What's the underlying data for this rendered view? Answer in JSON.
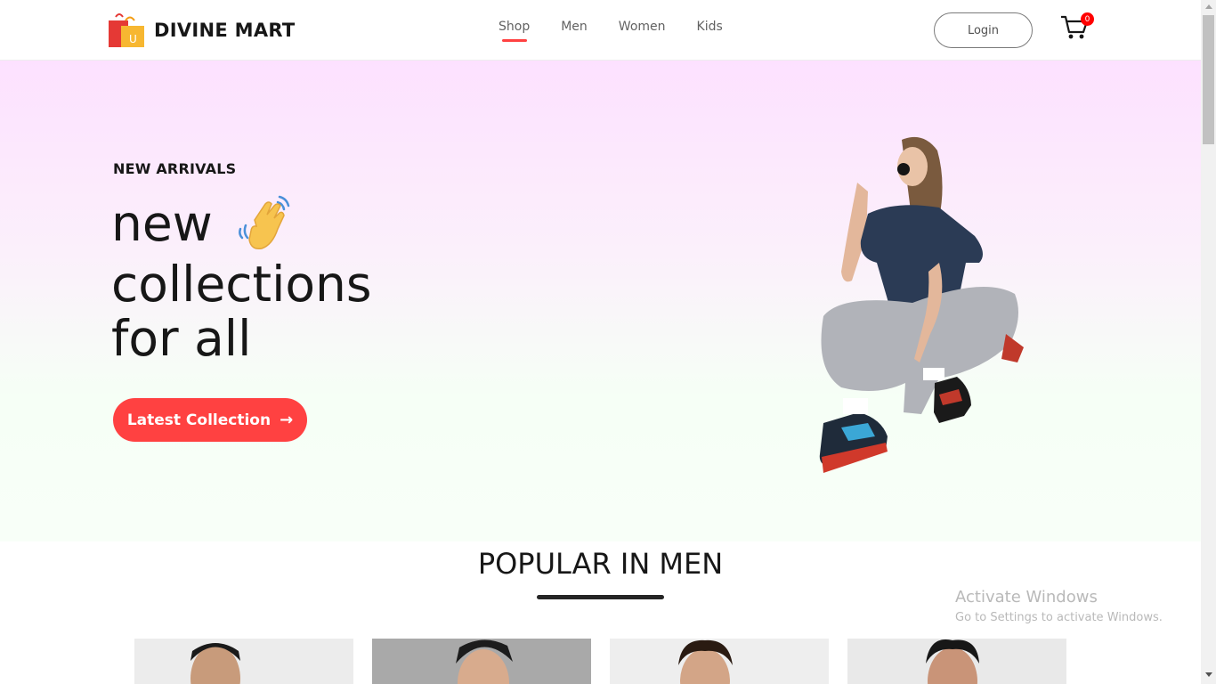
{
  "header": {
    "brand": "DIVINE MART",
    "logo_icon": "shopping-bag-icon",
    "nav": [
      {
        "label": "Shop",
        "active": true
      },
      {
        "label": "Men",
        "active": false
      },
      {
        "label": "Women",
        "active": false
      },
      {
        "label": "Kids",
        "active": false
      }
    ],
    "login_label": "Login",
    "cart_icon": "cart-icon",
    "cart_count": "0"
  },
  "hero": {
    "kicker": "NEW ARRIVALS",
    "line1": "new",
    "line2": "collections",
    "line3": "for all",
    "wave_icon": "waving-hand-icon",
    "button_label": "Latest Collection",
    "button_arrow": "→",
    "image": "model-squatting-image"
  },
  "section": {
    "title": "POPULAR IN MEN",
    "products": [
      {
        "image": "product-man-1-image"
      },
      {
        "image": "product-man-2-image"
      },
      {
        "image": "product-man-3-image"
      },
      {
        "image": "product-man-4-image"
      }
    ]
  },
  "watermark": {
    "title": "Activate Windows",
    "subtitle": "Go to Settings to activate Windows."
  },
  "colors": {
    "accent": "#ff4141",
    "badge": "#ff0000",
    "text": "#171717",
    "hero_top": "#fde1ff",
    "hero_bottom": "#f8fff8"
  }
}
